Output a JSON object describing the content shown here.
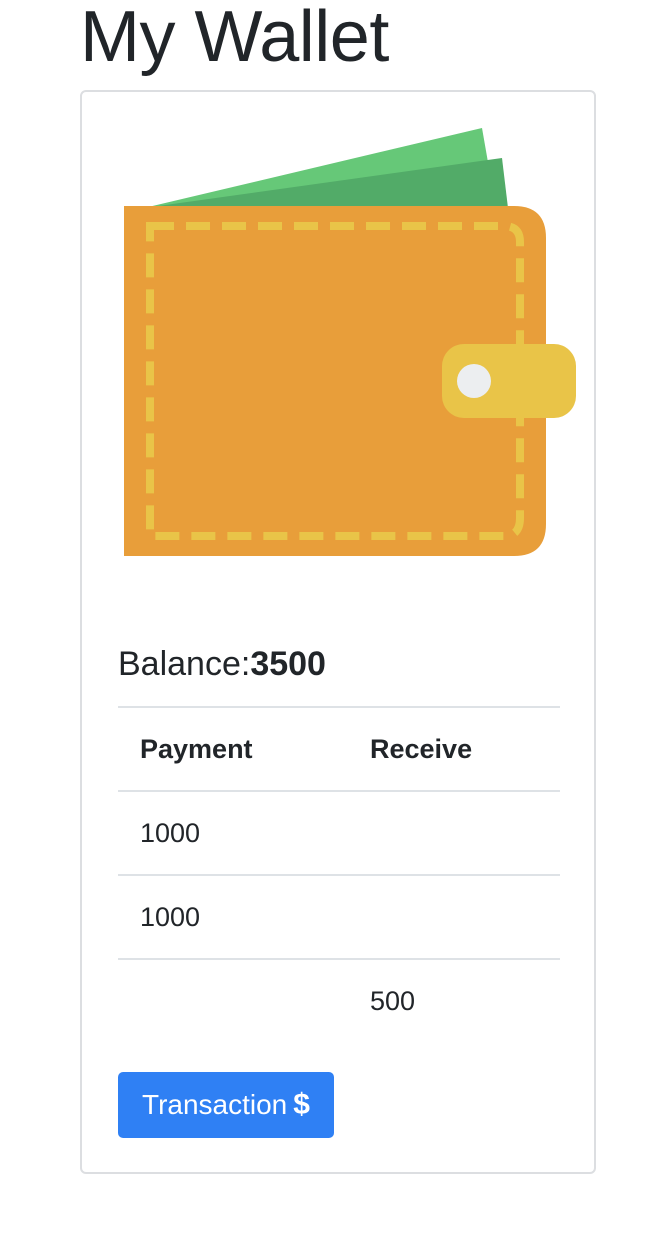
{
  "page": {
    "title": "My Wallet"
  },
  "wallet_card": {
    "illustration_icon": "wallet-icon",
    "balance_label": "Balance:",
    "balance_value": "3500",
    "table": {
      "headers": [
        "Payment",
        "Receive"
      ],
      "rows": [
        {
          "payment": "1000",
          "receive": ""
        },
        {
          "payment": "1000",
          "receive": ""
        },
        {
          "payment": "",
          "receive": "500"
        }
      ]
    },
    "transaction_button": {
      "label": "Transaction",
      "icon": "dollar-icon",
      "icon_glyph": "$"
    }
  },
  "colors": {
    "wallet_body": "#e89e3a",
    "wallet_stitch": "#e9c448",
    "wallet_clasp": "#e9c448",
    "money_light": "#66c878",
    "money_dark": "#52ab68",
    "button": "#2f80f4"
  }
}
